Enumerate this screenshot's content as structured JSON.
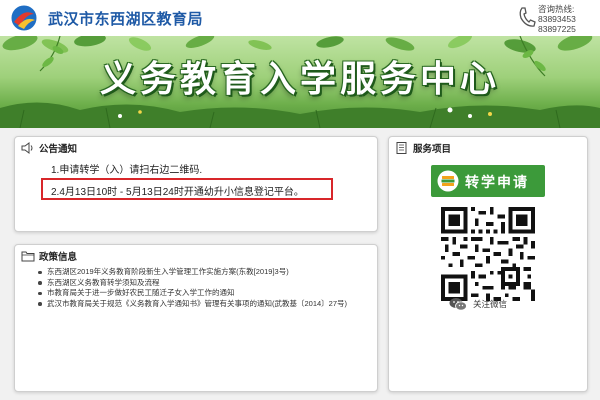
{
  "header": {
    "site_title": "武汉市东西湖区教育局",
    "hotline_label": "咨询热线:",
    "hotline_numbers": [
      "83893453",
      "83897225"
    ],
    "logo_icon": "bureau-logo-icon",
    "phone_icon": "phone-icon"
  },
  "banner": {
    "title": "义务教育入学服务中心"
  },
  "notice": {
    "title": "公告通知",
    "icon": "speaker-icon",
    "line1": "1.申请转学（入）请扫右边二维码.",
    "line2": "2.4月13日10时 - 5月13日24时开通幼升小信息登记平台。",
    "highlight_color": "#d8262a"
  },
  "policy": {
    "title": "政策信息",
    "icon": "folder-icon",
    "items": [
      "东西湖区2019年义务教育阶段新生入学管理工作实施方案(东教[2019]3号)",
      "东西湖区义务教育转学须知及流程",
      "市教育局关于进一步做好农民工随迁子女入学工作的通知",
      "武汉市教育局关于规范《义务教育入学通知书》管理有关事项的通知(武教基〔2014〕27号)"
    ]
  },
  "service": {
    "title": "服务项目",
    "icon": "document-icon",
    "transfer_label": "转学申请",
    "transfer_icon": "books-icon",
    "qr_icon": "qr-code-icon",
    "follow_label": "关注微信",
    "wechat_icon": "wechat-icon",
    "accent_color": "#3c9a3a"
  }
}
